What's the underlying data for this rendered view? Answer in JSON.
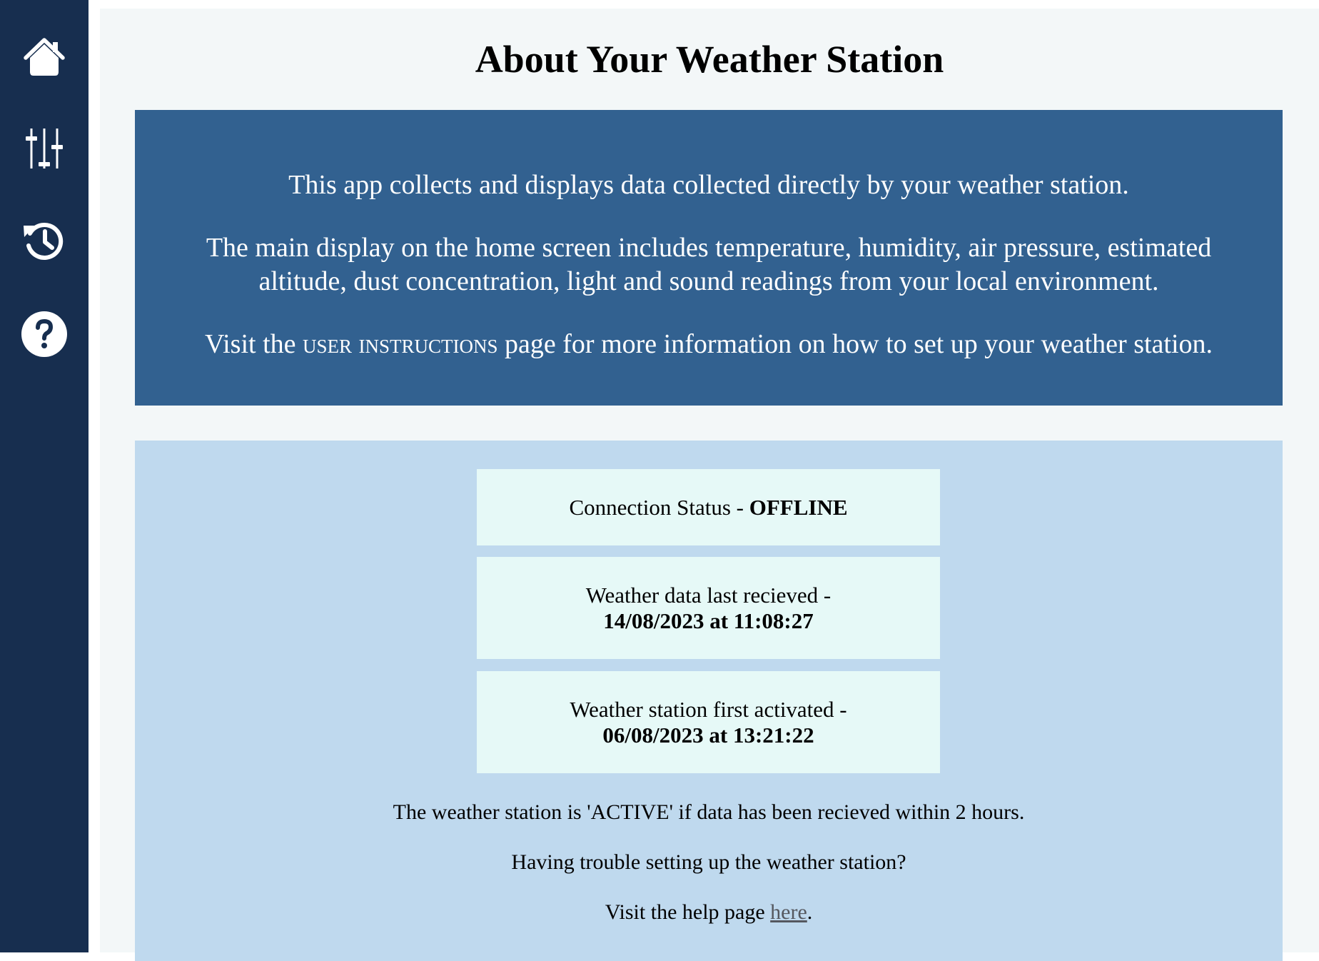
{
  "nav": {
    "items": [
      {
        "id": "home",
        "icon": "home-icon"
      },
      {
        "id": "settings",
        "icon": "sliders-icon"
      },
      {
        "id": "history",
        "icon": "history-icon"
      },
      {
        "id": "help",
        "icon": "help-icon"
      }
    ]
  },
  "page": {
    "title": "About Your Weather Station"
  },
  "intro": {
    "p1": "This app collects and displays data collected directly by your weather station.",
    "p2_line1": "The main display on the home screen includes temperature, humidity, air pressure, estimated",
    "p2_line2": "altitude, dust concentration, light and sound readings from your local environment.",
    "p3_before": "Visit the ",
    "p3_link": "user instructions",
    "p3_after": " page for more information on how to set up your weather station."
  },
  "status": {
    "connection_label": "Connection Status - ",
    "connection_value": "OFFLINE",
    "last_received_label": "Weather data last recieved -",
    "last_received_value": "14/08/2023 at 11:08:27",
    "first_activated_label": "Weather station first activated -",
    "first_activated_value": "06/08/2023 at 13:21:22",
    "active_note": "The weather station is 'ACTIVE' if data has been recieved within 2 hours.",
    "trouble_note": "Having trouble setting up the weather station?",
    "help_before": "Visit the help page ",
    "help_link": "here",
    "help_after": "."
  },
  "colors": {
    "sidebar": "#172e4f",
    "main_bg": "#f3f7f8",
    "intro_bg": "#326190",
    "status_bg": "#bfd9ee",
    "card_bg": "#e6f9f7"
  }
}
